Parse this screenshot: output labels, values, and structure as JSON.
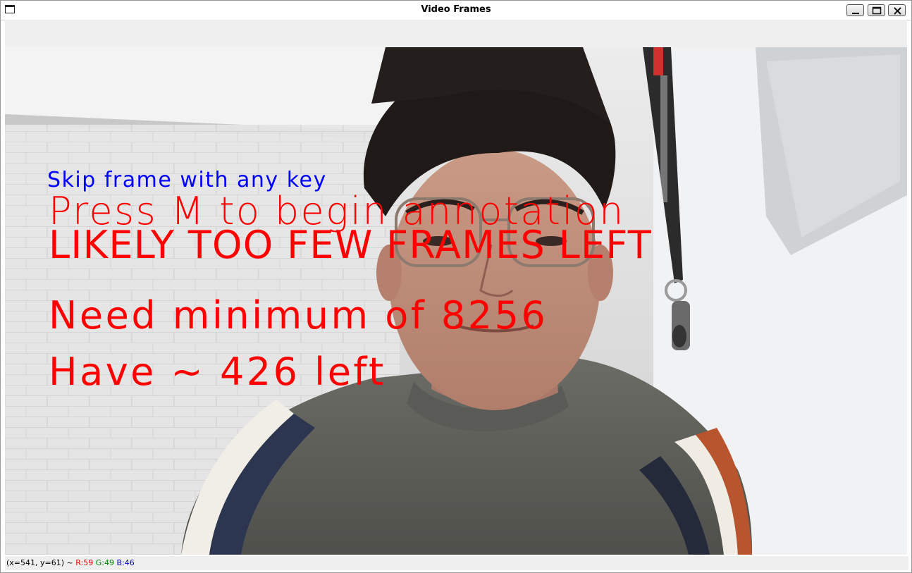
{
  "window": {
    "title": "Video Frames"
  },
  "overlay": {
    "skip_hint": "Skip frame with any key",
    "press_hint": "Press M to begin annotation",
    "warning": "LIKELY TOO FEW FRAMES LEFT",
    "need_line": "Need minimum of 8256",
    "have_line": "Have ~ 426 left"
  },
  "status": {
    "coords": "(x=541, y=61) ~",
    "r": "R:59",
    "g": "G:49",
    "b": "B:46"
  },
  "colors": {
    "overlay_blue": "#0000ff",
    "overlay_red": "#ff0000",
    "status_r": "#e00000",
    "status_g": "#008000",
    "status_b": "#0000cc"
  }
}
